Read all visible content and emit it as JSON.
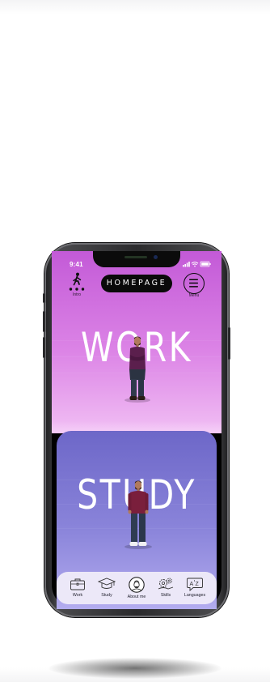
{
  "status_bar": {
    "time": "9:41"
  },
  "header": {
    "intro_label": "Intro",
    "title": "HOMEPAGE",
    "menu_label": "Menu"
  },
  "cards": {
    "work": {
      "word": "WORK",
      "color_top": "#c35ad7",
      "color_bottom": "#f1bff4"
    },
    "study": {
      "word": "STUDY",
      "color_top": "#6d67c8",
      "color_bottom": "#b3acef"
    }
  },
  "bottom_nav": {
    "items": [
      {
        "label": "Work",
        "icon": "briefcase-icon"
      },
      {
        "label": "Study",
        "icon": "graduation-cap-icon"
      },
      {
        "label": "About me",
        "icon": "avatar-icon"
      },
      {
        "label": "Skills",
        "icon": "gears-icon"
      },
      {
        "label": "Languages",
        "icon": "translate-icon"
      }
    ]
  }
}
